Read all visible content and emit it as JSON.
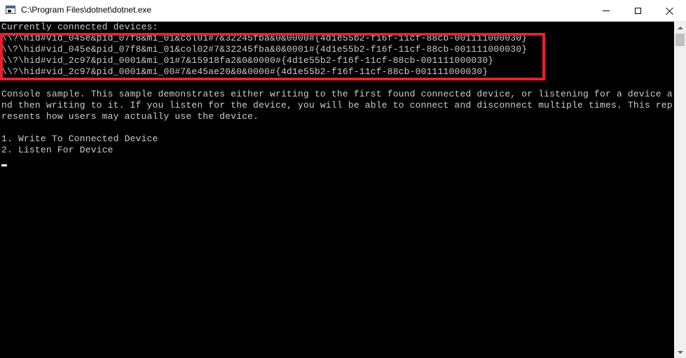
{
  "window": {
    "title": "C:\\Program Files\\dotnet\\dotnet.exe",
    "icon": "console-window-icon"
  },
  "console": {
    "lines": [
      "Currently connected devices:",
      "\\\\?\\hid#vid_045e&pid_07f8&mi_01&col01#7&32245fba&0&0000#{4d1e55b2-f16f-11cf-88cb-001111000030}",
      "\\\\?\\hid#vid_045e&pid_07f8&mi_01&col02#7&32245fba&0&0001#{4d1e55b2-f16f-11cf-88cb-001111000030}",
      "\\\\?\\hid#vid_2c97&pid_0001&mi_01#7&15918fa2&0&0000#{4d1e55b2-f16f-11cf-88cb-001111000030}",
      "\\\\?\\hid#vid_2c97&pid_0001&mi_00#7&e45ae20&0&0000#{4d1e55b2-f16f-11cf-88cb-001111000030}",
      "Console sample. This sample demonstrates either writing to the first found connected device, or listening for a device a",
      "nd then writing to it. If you listen for the device, you will be able to connect and disconnect multiple times. This rep",
      "resents how users may actually use the device.",
      "",
      "1. Write To Connected Device",
      "2. Listen For Device"
    ]
  },
  "colors": {
    "console_background": "#000000",
    "console_text": "#cccccc",
    "highlight": "#e8202a"
  }
}
